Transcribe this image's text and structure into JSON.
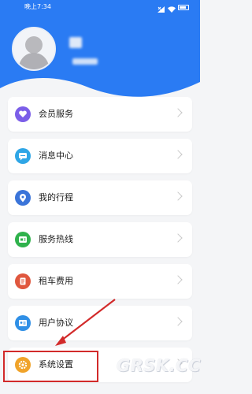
{
  "status_bar": {
    "time": "晚上7:34",
    "icons": [
      "signal-icon",
      "wifi-icon",
      "battery-icon"
    ]
  },
  "profile": {
    "avatar_icon": "default-user-avatar",
    "username_visible": false
  },
  "menu": {
    "items": [
      {
        "label": "会员服务",
        "icon": "member-heart-icon",
        "color": "#7b5ee8"
      },
      {
        "label": "消息中心",
        "icon": "message-icon",
        "color": "#2fa6e6"
      },
      {
        "label": "我的行程",
        "icon": "trip-pin-icon",
        "color": "#3a74d9"
      },
      {
        "label": "服务热线",
        "icon": "hotline-icon",
        "color": "#2fb24c"
      },
      {
        "label": "租车费用",
        "icon": "fee-icon",
        "color": "#e0573e"
      },
      {
        "label": "用户协议",
        "icon": "agreement-icon",
        "color": "#2f8fe6"
      },
      {
        "label": "系统设置",
        "icon": "settings-gear-icon",
        "color": "#f0a32a"
      }
    ]
  },
  "annotation": {
    "highlight_color": "#d22a2a",
    "highlighted_item": "系统设置"
  },
  "watermark": "GRSK.CC"
}
